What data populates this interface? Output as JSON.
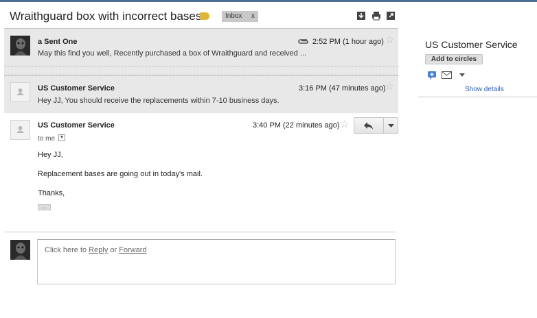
{
  "thread": {
    "subject": "Wraithguard box with incorrect bases",
    "label": "Inbox",
    "label_close": "x"
  },
  "messages": [
    {
      "sender": "a Sent One",
      "snippet": "May this find you well, Recently purchased a box of Wraithguard and received ...",
      "time": "2:52 PM (1 hour ago)",
      "has_attachment": true,
      "avatar": "dark-photo"
    },
    {
      "sender": "US Customer Service",
      "snippet": "Hey JJ, You should receive the replacements within 7-10 business days.",
      "time": "3:16 PM (47 minutes ago)",
      "avatar": "default-person"
    },
    {
      "sender": "US Customer Service",
      "time": "3:40 PM (22 minutes ago)",
      "to": "to me",
      "body": [
        "Hey JJ,",
        "Replacement bases are going out in today's mail.",
        "Thanks,"
      ],
      "quoted_toggle": "...",
      "avatar": "default-person"
    }
  ],
  "reply_box": {
    "prefix": "Click here to ",
    "reply_link": "Reply",
    "middle": " or ",
    "forward_link": "Forward"
  },
  "sidebar": {
    "contact_name": "US Customer Service",
    "circles_button": "Add to circles",
    "show_details": "Show details"
  },
  "icons": {
    "toolbar": [
      "download-icon",
      "print-icon",
      "new-window-icon"
    ],
    "sidebar": [
      "hangout-icon",
      "mail-icon",
      "dropdown-arrow-icon"
    ]
  },
  "colors": {
    "label_tag": "#e0b63a",
    "link": "#2a5db0",
    "collapsed_bg": "#e8e8e8"
  }
}
